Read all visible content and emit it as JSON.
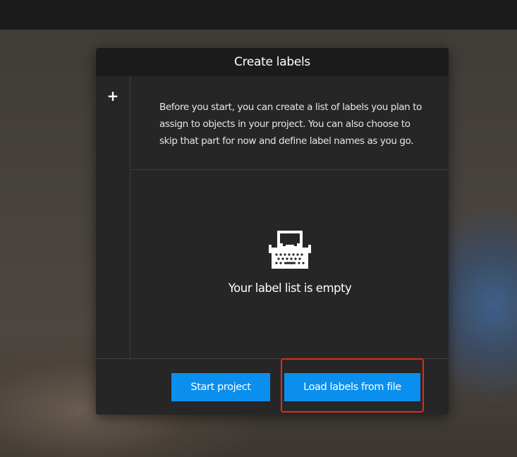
{
  "dialog": {
    "title": "Create labels",
    "add_button_symbol": "+",
    "intro_text": "Before you start, you can create a list of labels you plan to assign to objects in your project. You can also choose to skip that part for now and define label names as you go.",
    "empty_icon": "typewriter-icon",
    "empty_message": "Your label list is empty",
    "buttons": {
      "start": "Start project",
      "load": "Load labels from file"
    }
  },
  "colors": {
    "accent": "#0a8fef",
    "dialog_bg": "#262626",
    "header_bg": "#1b1b1b",
    "highlight": "#e02a20"
  }
}
